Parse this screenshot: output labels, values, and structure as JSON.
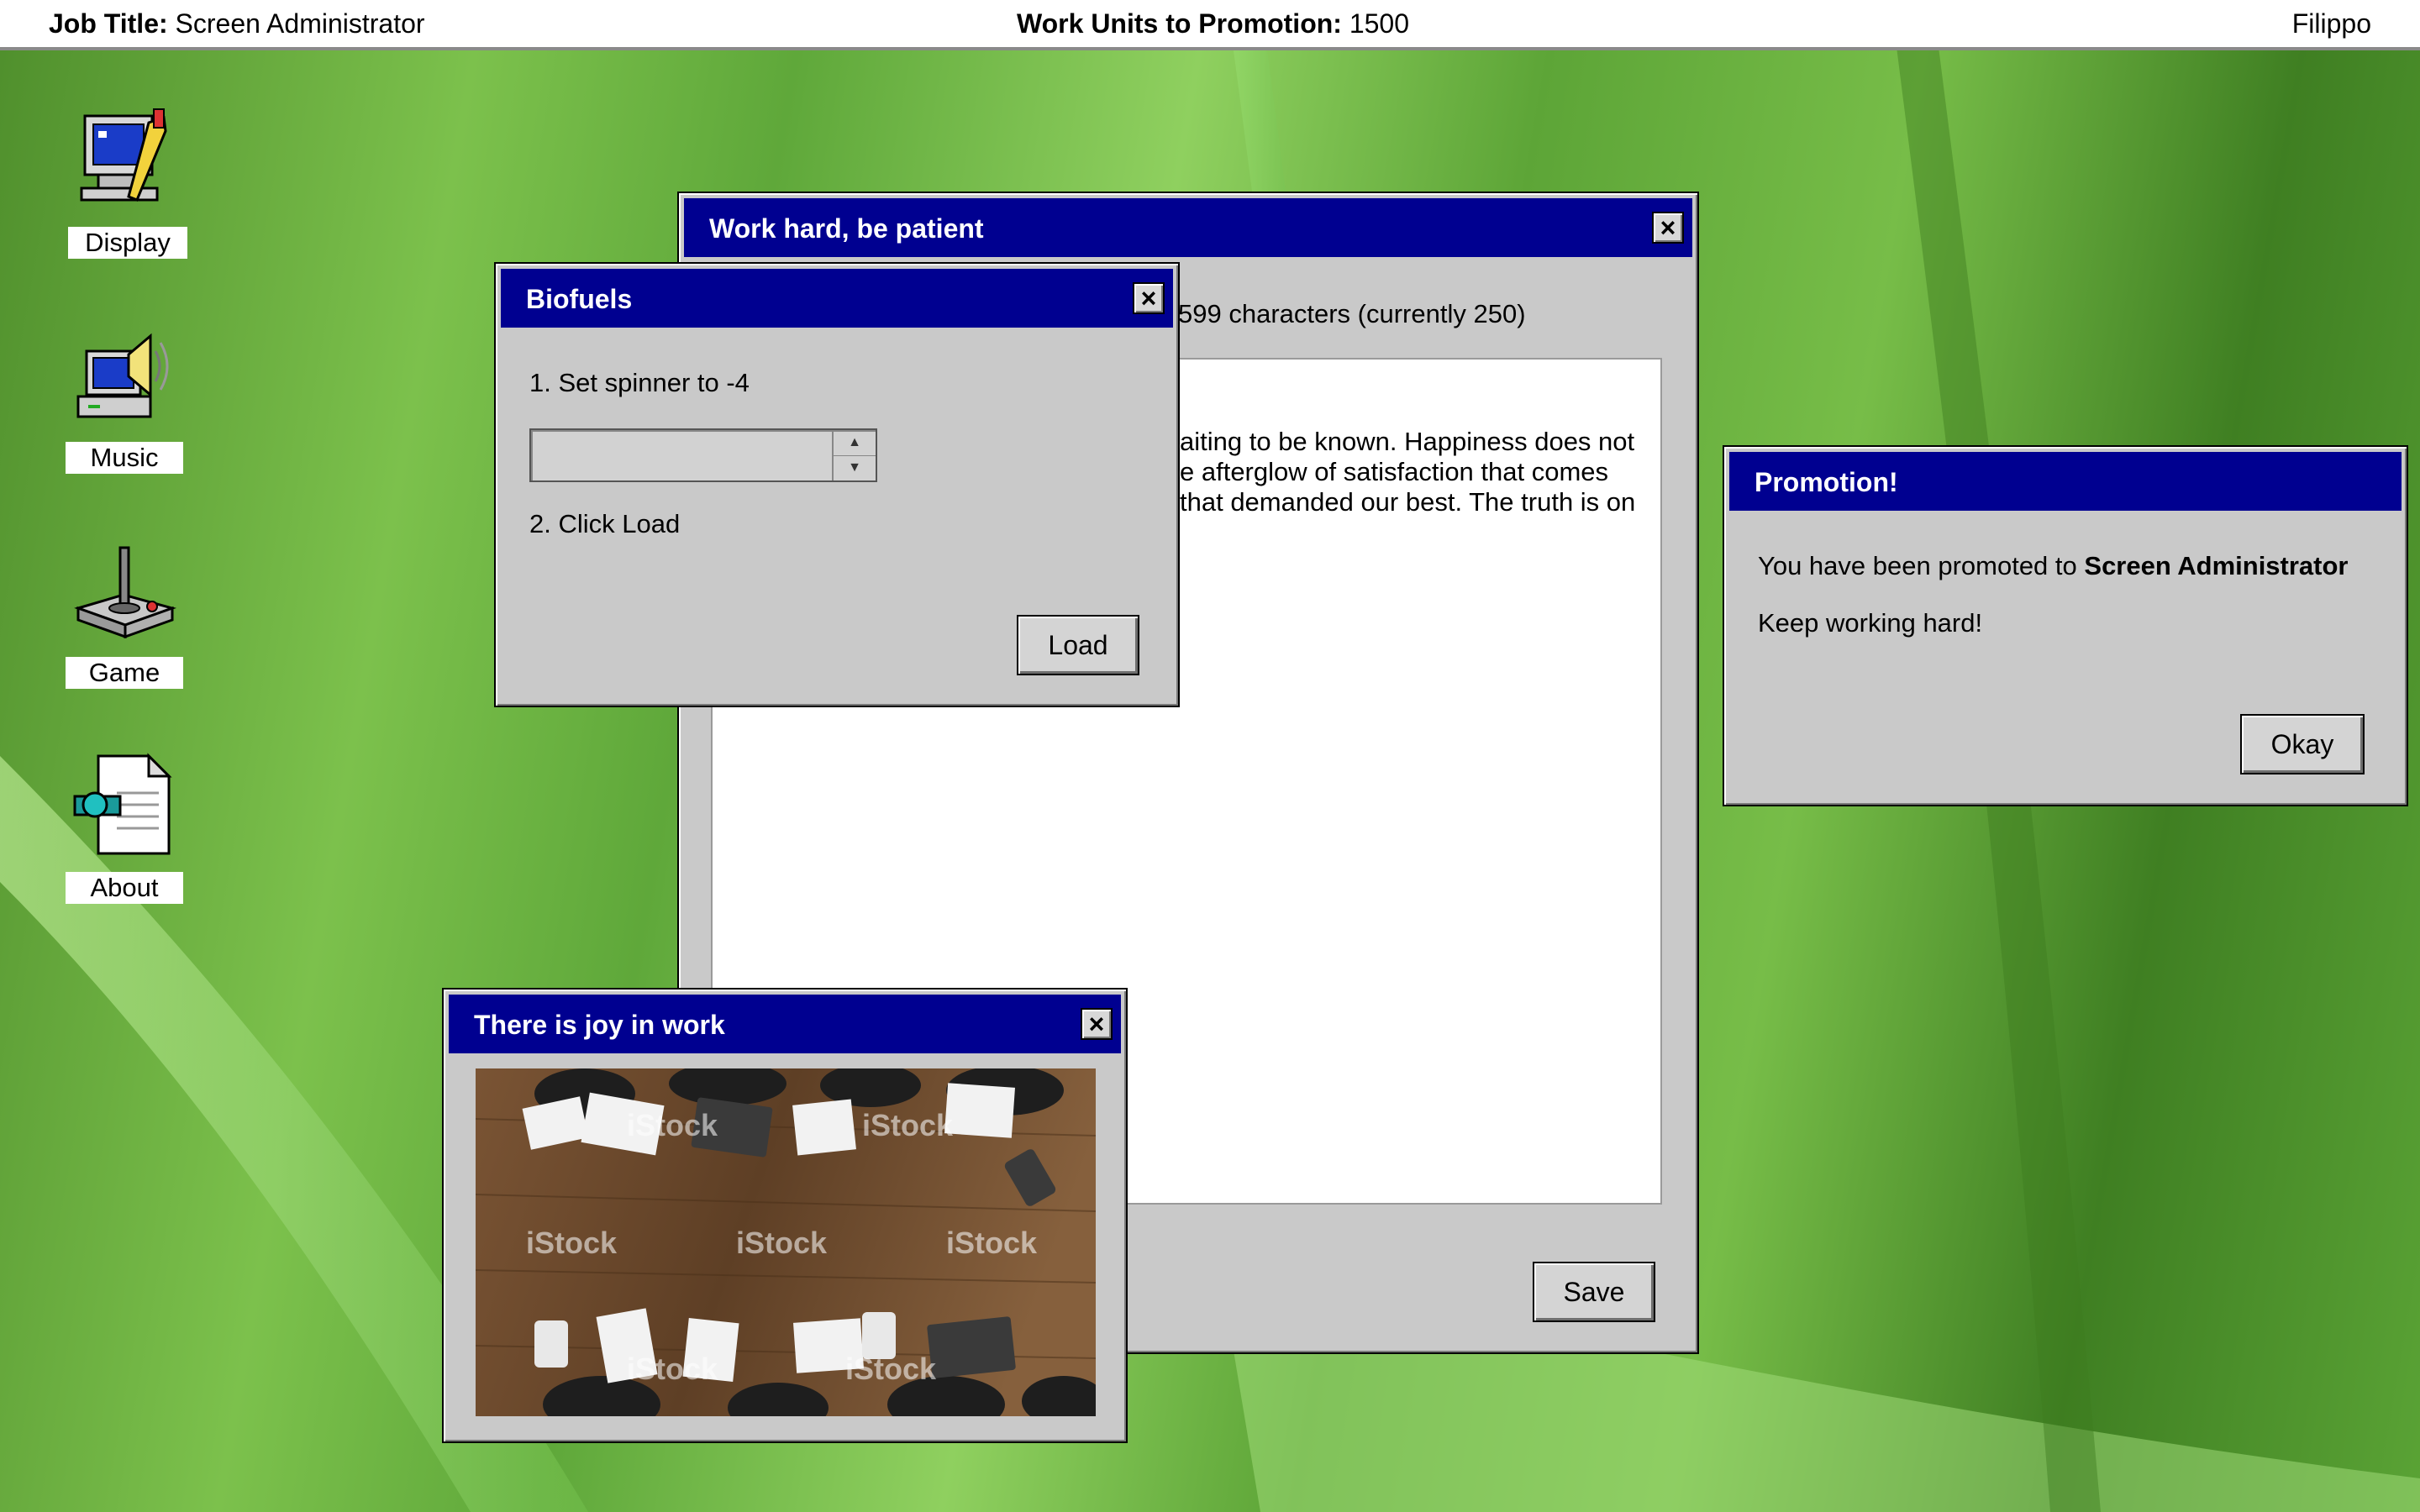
{
  "topbar": {
    "job_title_label": "Job Title:",
    "job_title_value": "Screen Administrator",
    "units_label": "Work Units to Promotion:",
    "units_value": "1500",
    "user": "Filippo"
  },
  "desktop_icons": [
    {
      "label": "Display",
      "icon": "display-icon"
    },
    {
      "label": "Music",
      "icon": "music-icon"
    },
    {
      "label": "Game",
      "icon": "game-joystick-icon"
    },
    {
      "label": "About",
      "icon": "about-document-icon"
    }
  ],
  "work_window": {
    "title": "Work hard, be patient",
    "char_info": "599 characters (currently 250)",
    "text_lines": [
      "aiting to be known. Happiness does not",
      "e afterglow of satisfaction that comes",
      "that demanded our best. The truth is on"
    ],
    "save_label": "Save"
  },
  "biofuels_window": {
    "title": "Biofuels",
    "step1": "1. Set spinner to -4",
    "spinner_value": "",
    "step2": "2. Click Load",
    "load_label": "Load"
  },
  "promotion_window": {
    "title": "Promotion!",
    "message_prefix": "You have been promoted to",
    "message_role": "Screen Administrator",
    "message2": "Keep working hard!",
    "okay_label": "Okay"
  },
  "joy_window": {
    "title": "There is joy in work",
    "watermark": "iStock"
  },
  "colors": {
    "titlebar": "#000090",
    "window": "#c9c9c9"
  }
}
